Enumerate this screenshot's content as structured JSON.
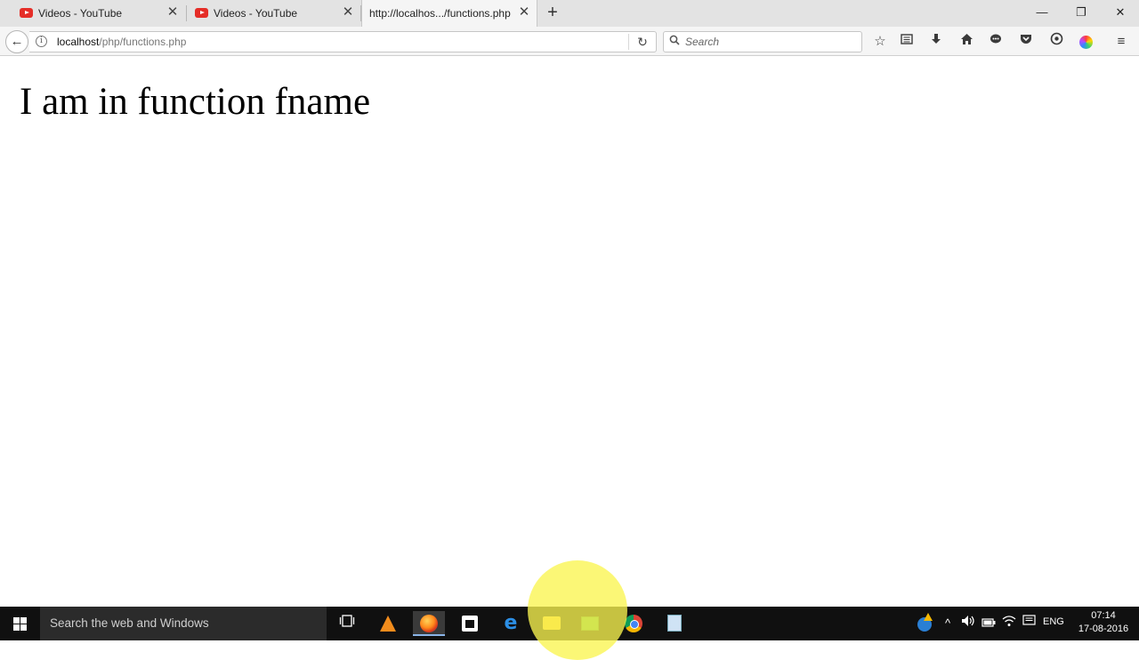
{
  "browser": {
    "tabs": [
      {
        "title": "Videos - YouTube",
        "close": "✕"
      },
      {
        "title": "Videos - YouTube",
        "close": "✕"
      },
      {
        "title": "http://localhos.../functions.php",
        "close": "✕"
      }
    ],
    "new_tab": "+",
    "window_controls": {
      "minimize": "—",
      "restore": "❐",
      "close": "✕"
    },
    "nav": {
      "back": "←",
      "info": "i",
      "url_host": "localhost",
      "url_path": "/php/functions.php",
      "reload": "↻",
      "search_placeholder": "Search"
    },
    "toolbar_icons": [
      "star-icon",
      "reading-list-icon",
      "download-icon",
      "home-icon",
      "chat-icon",
      "pocket-icon",
      "extension-icon",
      "color-wheel-icon",
      "menu-icon"
    ]
  },
  "page": {
    "heading": "I am in function fname"
  },
  "taskbar": {
    "search_placeholder": "Search the web and Windows",
    "apps": [
      "task-view-icon",
      "vlc-icon",
      "firefox-icon",
      "store-icon",
      "edge-icon",
      "file-explorer-icon",
      "sheets-icon",
      "chrome-icon",
      "notepad-icon"
    ],
    "language": "ENG",
    "time": "07:14",
    "date": "17-08-2016"
  },
  "colors": {
    "youtube_red": "#e52d27",
    "cursor_highlight": "#faf550",
    "taskbar_bg": "#101010"
  }
}
